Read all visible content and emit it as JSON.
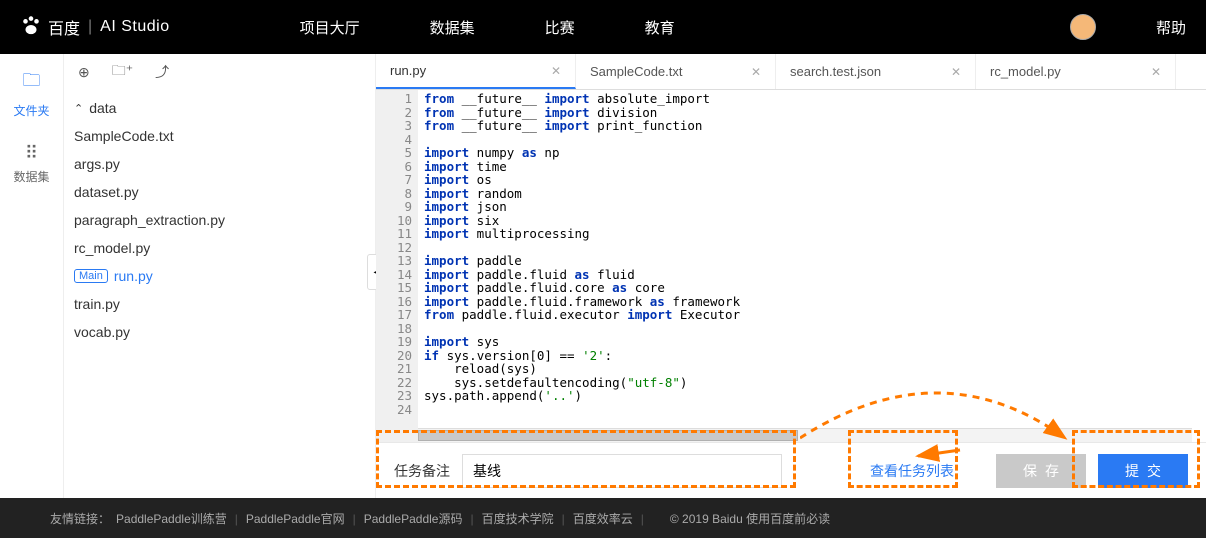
{
  "header": {
    "brand_text": "百度",
    "brand_sub": "AI Studio",
    "nav": [
      "项目大厅",
      "数据集",
      "比赛",
      "教育"
    ],
    "help": "帮助"
  },
  "left_rail": {
    "files": {
      "label": "文件夹"
    },
    "datasets": {
      "label": "数据集"
    }
  },
  "tree": {
    "folder": "data",
    "files": [
      "SampleCode.txt",
      "args.py",
      "dataset.py",
      "paragraph_extraction.py",
      "rc_model.py",
      "run.py",
      "train.py",
      "vocab.py"
    ],
    "main_badge": "Main",
    "main_file_index": 5
  },
  "tabs": [
    {
      "label": "run.py",
      "active": true
    },
    {
      "label": "SampleCode.txt",
      "active": false
    },
    {
      "label": "search.test.json",
      "active": false
    },
    {
      "label": "rc_model.py",
      "active": false
    }
  ],
  "code_lines": [
    [
      [
        "from",
        "kw"
      ],
      [
        " __future__ ",
        "p"
      ],
      [
        "import",
        "kw"
      ],
      [
        " absolute_import",
        "p"
      ]
    ],
    [
      [
        "from",
        "kw"
      ],
      [
        " __future__ ",
        "p"
      ],
      [
        "import",
        "kw"
      ],
      [
        " division",
        "p"
      ]
    ],
    [
      [
        "from",
        "kw"
      ],
      [
        " __future__ ",
        "p"
      ],
      [
        "import",
        "kw"
      ],
      [
        " print_function",
        "p"
      ]
    ],
    [
      [
        "",
        "p"
      ]
    ],
    [
      [
        "import",
        "kw"
      ],
      [
        " numpy ",
        "p"
      ],
      [
        "as",
        "kw"
      ],
      [
        " np",
        "p"
      ]
    ],
    [
      [
        "import",
        "kw"
      ],
      [
        " time",
        "p"
      ]
    ],
    [
      [
        "import",
        "kw"
      ],
      [
        " os",
        "p"
      ]
    ],
    [
      [
        "import",
        "kw"
      ],
      [
        " random",
        "p"
      ]
    ],
    [
      [
        "import",
        "kw"
      ],
      [
        " json",
        "p"
      ]
    ],
    [
      [
        "import",
        "kw"
      ],
      [
        " six",
        "p"
      ]
    ],
    [
      [
        "import",
        "kw"
      ],
      [
        " multiprocessing",
        "p"
      ]
    ],
    [
      [
        "",
        "p"
      ]
    ],
    [
      [
        "import",
        "kw"
      ],
      [
        " paddle",
        "p"
      ]
    ],
    [
      [
        "import",
        "kw"
      ],
      [
        " paddle.fluid ",
        "p"
      ],
      [
        "as",
        "kw"
      ],
      [
        " fluid",
        "p"
      ]
    ],
    [
      [
        "import",
        "kw"
      ],
      [
        " paddle.fluid.core ",
        "p"
      ],
      [
        "as",
        "kw"
      ],
      [
        " core",
        "p"
      ]
    ],
    [
      [
        "import",
        "kw"
      ],
      [
        " paddle.fluid.framework ",
        "p"
      ],
      [
        "as",
        "kw"
      ],
      [
        " framework",
        "p"
      ]
    ],
    [
      [
        "from",
        "kw"
      ],
      [
        " paddle.fluid.executor ",
        "p"
      ],
      [
        "import",
        "kw"
      ],
      [
        " Executor",
        "p"
      ]
    ],
    [
      [
        "",
        "p"
      ]
    ],
    [
      [
        "import",
        "kw"
      ],
      [
        " sys",
        "p"
      ]
    ],
    [
      [
        "if",
        "kw"
      ],
      [
        " sys.version[0] == ",
        "p"
      ],
      [
        "'2'",
        "str"
      ],
      [
        ":",
        "p"
      ]
    ],
    [
      [
        "    reload(sys)",
        "p"
      ]
    ],
    [
      [
        "    sys.setdefaultencoding(",
        "p"
      ],
      [
        "\"utf-8\"",
        "str"
      ],
      [
        ")",
        "p"
      ]
    ],
    [
      [
        "sys.path.append(",
        "p"
      ],
      [
        "'..'",
        "str"
      ],
      [
        ")",
        "p"
      ]
    ],
    [
      [
        "",
        "p"
      ]
    ]
  ],
  "submit": {
    "label": "任务备注",
    "value": "基线",
    "view_link": "查看任务列表",
    "save": "保存",
    "submit": "提交"
  },
  "footer": {
    "prefix": "友情链接：",
    "links": [
      "PaddlePaddle训练营",
      "PaddlePaddle官网",
      "PaddlePaddle源码",
      "百度技术学院",
      "百度效率云"
    ],
    "copyright": "© 2019 Baidu 使用百度前必读"
  }
}
